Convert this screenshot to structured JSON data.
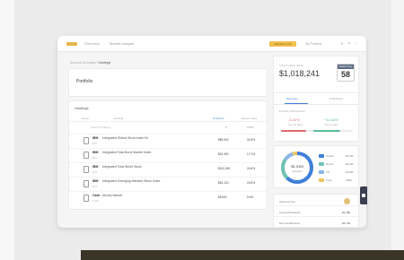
{
  "topbar": {
    "nav": [
      "Overview",
      "Market Insights"
    ],
    "promo_label": "Upgrade to Pro",
    "account_label": "My Portfolio"
  },
  "breadcrumb": {
    "parent": "Account Summary",
    "current": "Holdings"
  },
  "portfolio": {
    "title": "Portfolio"
  },
  "holdings": {
    "title": "Holdings",
    "columns": [
      "Name",
      "Holding",
      "% Return",
      "Market Value"
    ],
    "search_placeholder": "Search holdings...",
    "count_label": "5",
    "total_label": "100%",
    "rows": [
      {
        "symbol": "IBM",
        "name": "Integrated Global Stock Index Ex",
        "sub": "ETF",
        "value": "$89,400",
        "change": "32.8%"
      },
      {
        "symbol": "IBM",
        "name": "Integrated Total Bond Market Index",
        "sub": "ETF",
        "value": "$22,490",
        "change": "17.2%"
      },
      {
        "symbol": "IBM",
        "name": "Integrated Total World Stock",
        "sub": "ETF",
        "value": "$102,400",
        "change": "24.6%"
      },
      {
        "symbol": "IBM",
        "name": "Integrated Emerging Markets Stock Index",
        "sub": "ETF",
        "value": "$61,120",
        "change": "15.5%"
      },
      {
        "symbol": "Cash",
        "name": "Money Market",
        "sub": "Cash",
        "value": "$9,831",
        "change": "9.9%"
      }
    ]
  },
  "summary": {
    "label": "Total Portfolio Value",
    "amount": "$1,018,241",
    "score_label": "Wealth Score",
    "score": "58",
    "tabs": [
      "Summary",
      "Projections"
    ]
  },
  "performance": {
    "label": "Portfolio Performance",
    "left_value": "-3.42%",
    "left_sub": "Last 30 days",
    "right_value": "+12.80%",
    "right_sub": "Year to date",
    "left_color": "#e06a6a",
    "right_color": "#5bbf95"
  },
  "allocation": {
    "center_value": "$1.01M",
    "center_label": "Allocated",
    "items": [
      {
        "name": "Stocks",
        "pct": "62.4%",
        "color": "#3f7fd9",
        "fraction": 0.624
      },
      {
        "name": "Bonds",
        "pct": "22.1%",
        "color": "#6fc2b4",
        "fraction": 0.221
      },
      {
        "name": "Intl",
        "pct": "10.6%",
        "color": "#8bb6e8",
        "fraction": 0.106
      },
      {
        "name": "Cash",
        "pct": "4.9%",
        "color": "#f0c260",
        "fraction": 0.049
      }
    ]
  },
  "details": [
    {
      "label": "Advisory Fee",
      "value": ""
    },
    {
      "label": "Annual Dividends",
      "value": "$2,480"
    },
    {
      "label": "Net Contributions",
      "value": "$4,100"
    }
  ]
}
